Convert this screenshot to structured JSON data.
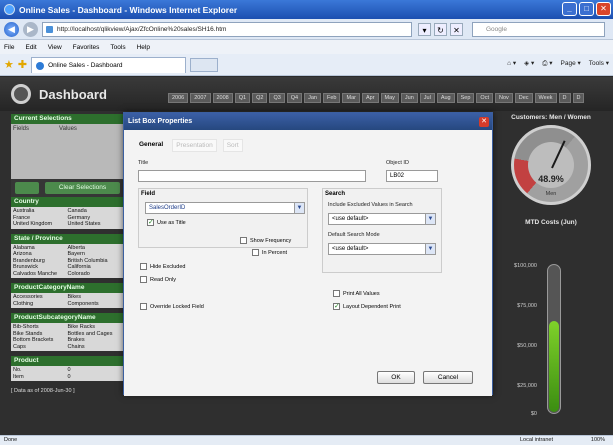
{
  "browser": {
    "window_title": "Online Sales - Dashboard - Windows Internet Explorer",
    "url": "http://localhost/qlikview/Ajax/ZfcOnline%20sales/SH16.htm",
    "search_placeholder": "Google",
    "menu": [
      "File",
      "Edit",
      "View",
      "Favorites",
      "Tools",
      "Help"
    ],
    "tab_title": "Online Sales - Dashboard",
    "tools": [
      "Page ▾",
      "Tools ▾"
    ],
    "status_text": "Done",
    "zone_text": "Local intranet",
    "zoom": "100%"
  },
  "app": {
    "title": "Dashboard",
    "periods": [
      "2006",
      "2007",
      "2008",
      "Q1",
      "Q2",
      "Q3",
      "Q4",
      "Jan",
      "Feb",
      "Mar",
      "Apr",
      "May",
      "Jun",
      "Jul",
      "Aug",
      "Sep",
      "Oct",
      "Nov",
      "Dec",
      "Week",
      "D",
      "D"
    ],
    "current_selections": {
      "header": "Current Selections",
      "col1": "Fields",
      "col2": "Values",
      "clear_label": "Clear Selections"
    },
    "listboxes": [
      {
        "header": "Country",
        "items": [
          "Australia",
          "Canada",
          "France",
          "Germany",
          "United Kingdom",
          "United States"
        ]
      },
      {
        "header": "State / Province",
        "items": [
          "Alabama",
          "Alberta",
          "Arizona",
          "Bayern",
          "Brandenburg",
          "British Columbia",
          "Brunswick",
          "California",
          "Calvados Manche",
          "Colorado"
        ]
      },
      {
        "header": "ProductCategoryName",
        "items": [
          "Accessories",
          "Bikes",
          "Clothing",
          "Components"
        ]
      },
      {
        "header": "ProductSubcategoryName",
        "items": [
          "Bib-Shorts",
          "Bike Racks",
          "Bike Stands",
          "Bottles and Cages",
          "Bottom Brackets",
          "Brakes",
          "Caps",
          "Chains"
        ]
      },
      {
        "header": "Product",
        "items": [
          "No.",
          "0",
          "Item",
          "0"
        ]
      }
    ],
    "data_note": "[ Data as of 2008-Jun-30 ]",
    "customers": {
      "title": "Customers: Men / Women",
      "value": "48.9%",
      "label": "Men"
    },
    "mtd": {
      "title": "MTD Costs (Jun)",
      "ticks": [
        "$100,000",
        "$75,000",
        "$50,000",
        "$25,000",
        "$0"
      ],
      "fill_fraction": 0.62
    }
  },
  "dialog": {
    "title": "List Box Properties",
    "tabs": [
      "General",
      "Presentation",
      "Sort"
    ],
    "title_label": "Title",
    "title_value": "",
    "object_id_label": "Object ID",
    "object_id_value": "LB02",
    "field_label": "Field",
    "field_value": "SalesOrderID",
    "use_as_title": "Use as Title",
    "search_label": "Search",
    "include_excluded_label": "Include Excluded Values in Search",
    "include_excluded_value": "<use default>",
    "default_search_mode_label": "Default Search Mode",
    "default_search_mode_value": "<use default>",
    "show_frequency": "Show Frequency",
    "in_percent": "In Percent",
    "hide_excluded": "Hide Excluded",
    "read_only": "Read Only",
    "print_all_values": "Print All Values",
    "override_locked": "Override Locked Field",
    "layout_dependent_print": "Layout Dependent Print",
    "ok": "OK",
    "cancel": "Cancel"
  }
}
